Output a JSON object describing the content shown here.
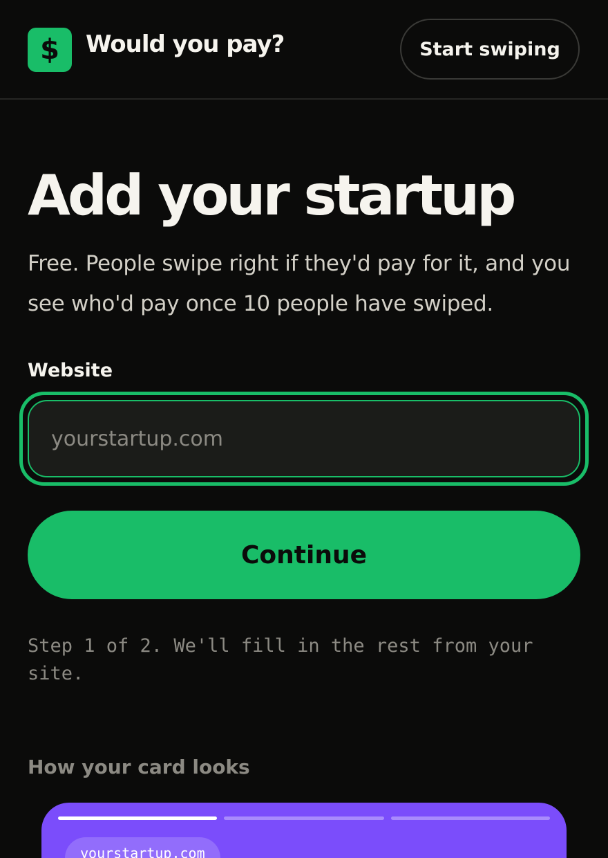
{
  "header": {
    "logo_glyph": "$",
    "logo_icon": "dollar-icon",
    "app_title": "Would you pay?",
    "start_button_label": "Start swiping"
  },
  "main": {
    "title": "Add your startup",
    "subtitle": "Free. People swipe right if they'd pay for it, and you see who'd pay once 10 people have swiped.",
    "website_label": "Website",
    "website_value": "",
    "website_placeholder": "yourstartup.com",
    "continue_label": "Continue",
    "step_note": "Step 1 of 2. We'll fill in the rest from your site."
  },
  "preview": {
    "heading": "How your card looks",
    "progress_total": 3,
    "progress_current": 1,
    "chip_text": "yourstartup.com"
  },
  "colors": {
    "accent": "#19bd68",
    "background": "#0b0b0a",
    "card": "#7b4dfb"
  }
}
